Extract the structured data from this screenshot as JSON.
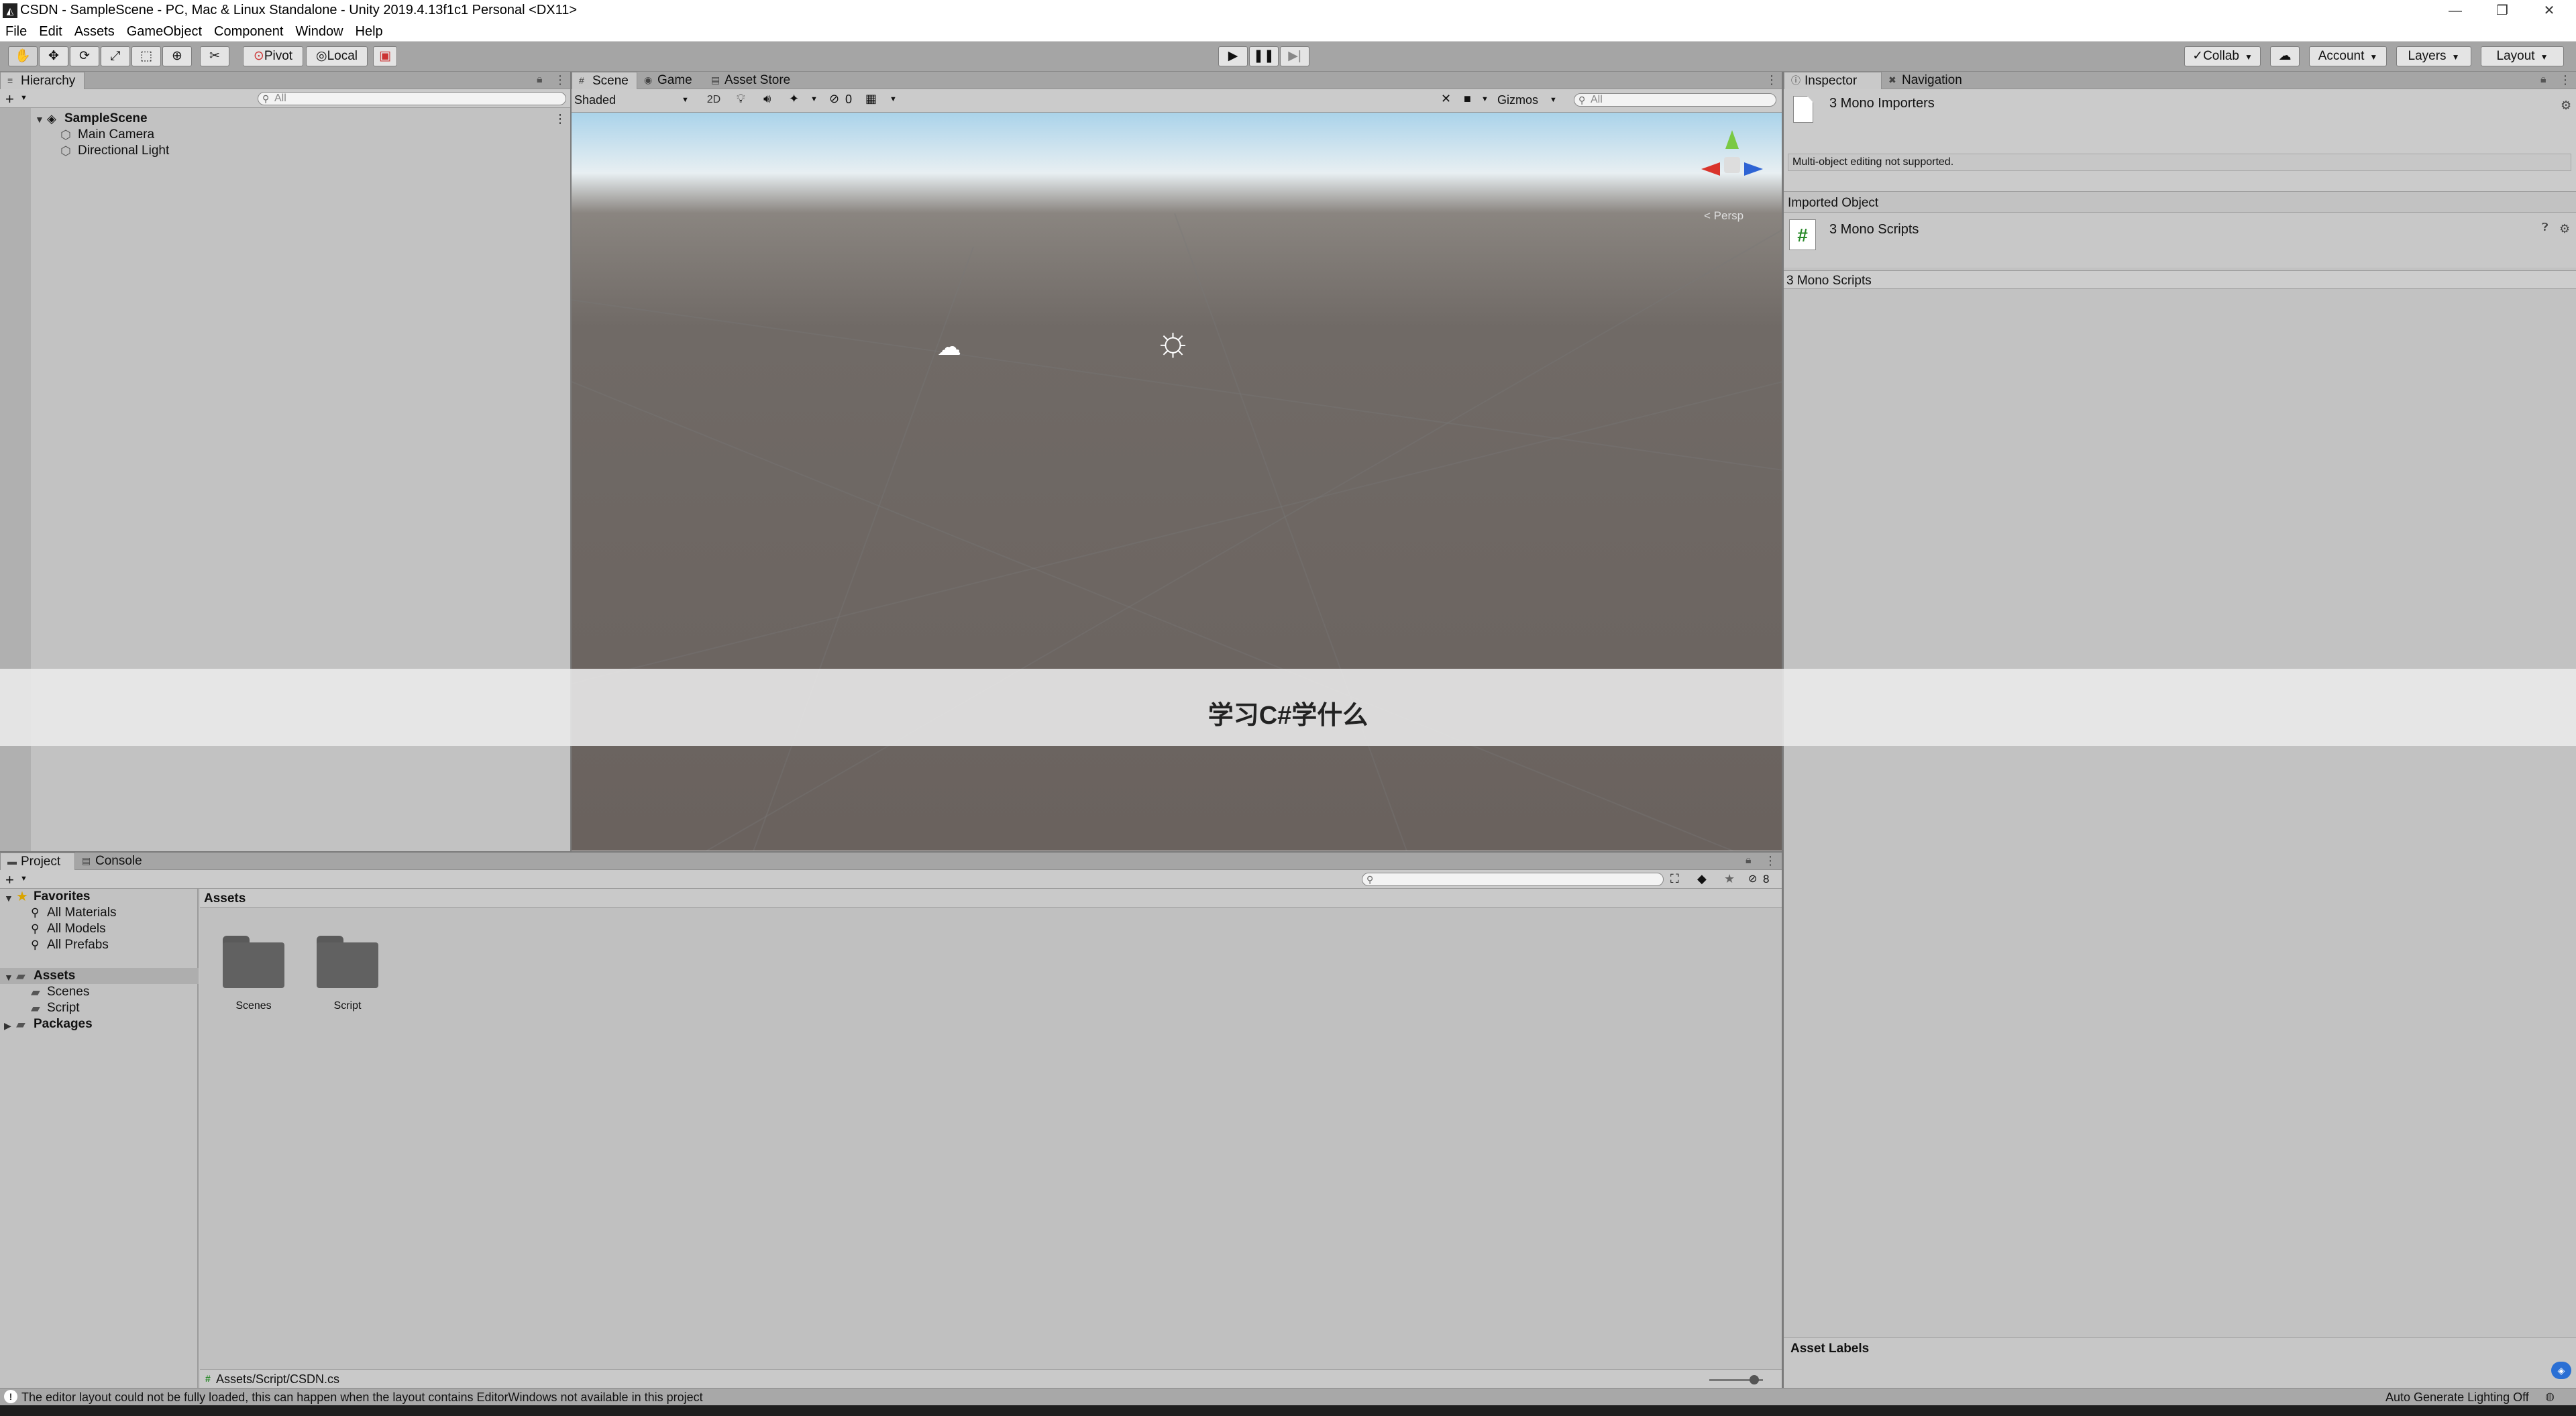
{
  "window": {
    "title": "CSDN - SampleScene - PC, Mac & Linux Standalone - Unity 2019.4.13f1c1 Personal <DX11>",
    "minimize": "—",
    "restore": "❐",
    "close": "✕"
  },
  "menu": [
    "File",
    "Edit",
    "Assets",
    "GameObject",
    "Component",
    "Window",
    "Help"
  ],
  "toolbar": {
    "pivot": "Pivot",
    "local": "Local",
    "collab": "Collab",
    "account": "Account",
    "layers": "Layers",
    "layout": "Layout"
  },
  "hierarchy": {
    "tab": "Hierarchy",
    "search_placeholder": "All",
    "scene": "SampleScene",
    "items": [
      "Main Camera",
      "Directional Light"
    ]
  },
  "scene_view": {
    "tabs": [
      "Scene",
      "Game",
      "Asset Store"
    ],
    "shading": "Shaded",
    "mode_2d": "2D",
    "hidden_count": "0",
    "gizmos": "Gizmos",
    "search_placeholder": "All",
    "persp": "< Persp"
  },
  "overlay_text": "学习C#学什么",
  "inspector": {
    "tabs": [
      "Inspector",
      "Navigation"
    ],
    "header": "3 Mono Importers",
    "notice": "Multi-object editing not supported.",
    "imported_object": "Imported Object",
    "scripts_title": "3 Mono Scripts",
    "scripts_bar": "3 Mono Scripts",
    "asset_labels": "Asset Labels"
  },
  "project": {
    "tabs": [
      "Project",
      "Console"
    ],
    "favorites": "Favorites",
    "favorites_items": [
      "All Materials",
      "All Models",
      "All Prefabs"
    ],
    "assets": "Assets",
    "assets_children": [
      "Scenes",
      "Script"
    ],
    "packages": "Packages",
    "breadcrumb": "Assets",
    "folders": [
      "Scenes",
      "Script"
    ],
    "path": "Assets/Script/CSDN.cs",
    "hidden_count": "8"
  },
  "status": {
    "message": "The editor layout could not be fully loaded, this can happen when the layout contains EditorWindows not available in this project",
    "lighting": "Auto Generate Lighting Off"
  }
}
